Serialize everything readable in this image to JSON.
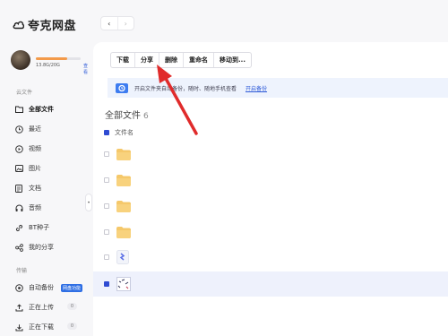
{
  "app": {
    "name": "夸克网盘"
  },
  "user": {
    "quota_text": "13.8G/20G",
    "quota_fraction": 0.69,
    "view_link": "查看"
  },
  "nav": {
    "back": "‹",
    "forward": "›"
  },
  "sidebar": {
    "cloud_label": "云文件",
    "items": [
      {
        "label": "全部文件",
        "icon": "folder-icon",
        "active": true
      },
      {
        "label": "最近",
        "icon": "clock-icon"
      },
      {
        "label": "视频",
        "icon": "play-icon"
      },
      {
        "label": "图片",
        "icon": "image-icon"
      },
      {
        "label": "文档",
        "icon": "document-icon"
      },
      {
        "label": "音频",
        "icon": "headphones-icon"
      },
      {
        "label": "BT种子",
        "icon": "link-icon"
      },
      {
        "label": "我的分享",
        "icon": "share-icon"
      }
    ],
    "transfer_label": "传输",
    "transfer_items": [
      {
        "label": "自动备份",
        "badge": "网盘功能"
      },
      {
        "label": "正在上传",
        "count": "0"
      },
      {
        "label": "正在下载",
        "count": "0"
      }
    ]
  },
  "toolbar": {
    "download": "下载",
    "share": "分享",
    "delete": "删除",
    "rename": "重命名",
    "move": "移动到..."
  },
  "banner": {
    "text": "开启文件夹自动备份，随时、随地手机查看",
    "link": "开启备份"
  },
  "heading": {
    "title": "全部文件",
    "count": "6"
  },
  "columns": {
    "name": "文件名"
  },
  "colors": {
    "accent": "#2f4bd2",
    "folder": "#f5c86a",
    "arrow": "#e02b2b"
  },
  "rows": [
    {
      "type": "folder"
    },
    {
      "type": "folder"
    },
    {
      "type": "folder"
    },
    {
      "type": "folder"
    },
    {
      "type": "file-blue"
    },
    {
      "type": "image-file",
      "selected": true
    }
  ]
}
